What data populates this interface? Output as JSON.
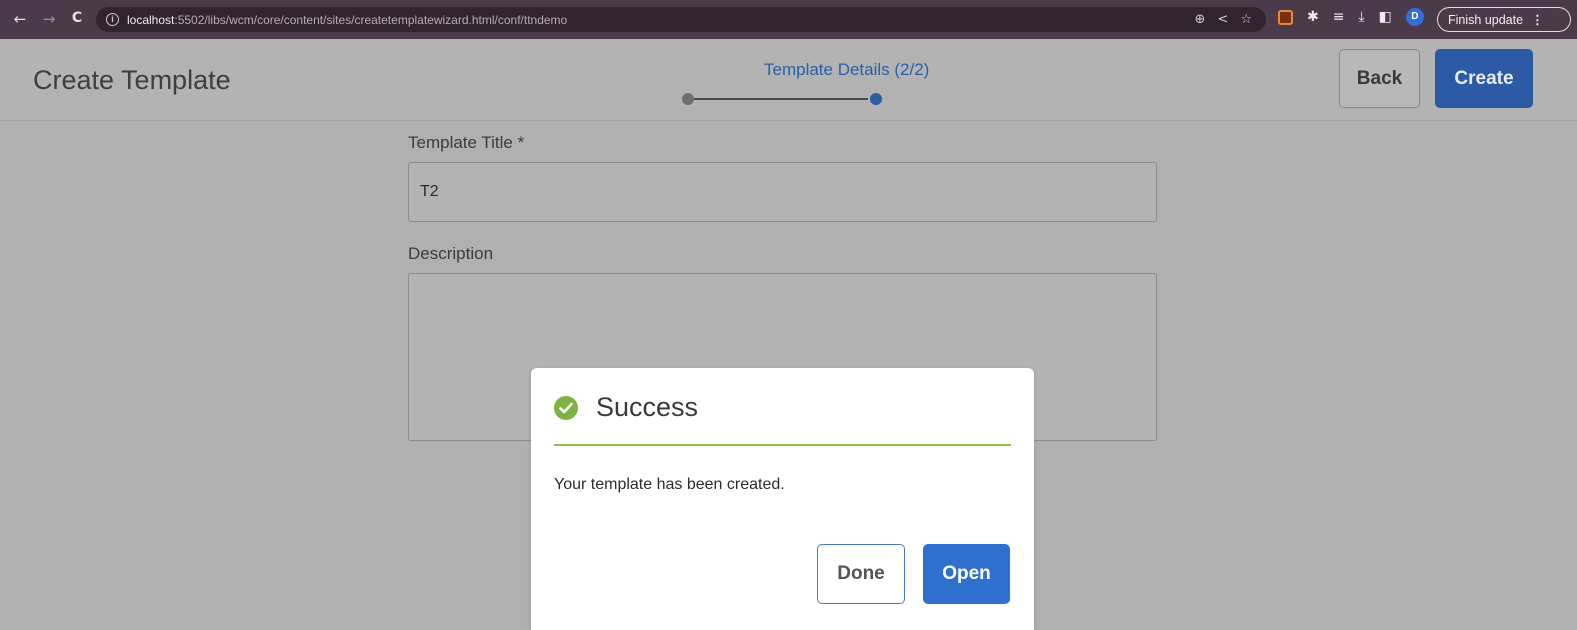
{
  "browser": {
    "back_icon": "←",
    "forward_icon": "→",
    "reload_icon": "C",
    "info_icon": "i",
    "url_host": "localhost",
    "url_rest": ":5502/libs/wcm/core/content/sites/createtemplatewizard.html/conf/ttndemo",
    "profile_initial": "D",
    "finish_update_label": "Finish update",
    "menu_icon": "⋮"
  },
  "header": {
    "title": "Create Template",
    "step_label": "Template Details (2/2)",
    "back_label": "Back",
    "create_label": "Create"
  },
  "form": {
    "title_label": "Template Title *",
    "title_value": "T2",
    "description_label": "Description",
    "description_value": ""
  },
  "dialog": {
    "title": "Success",
    "message": "Your template has been created.",
    "done_label": "Done",
    "open_label": "Open"
  },
  "colors": {
    "accent": "#2c5aa5",
    "success": "#7cb342",
    "overlay": "#b0b0b0"
  }
}
